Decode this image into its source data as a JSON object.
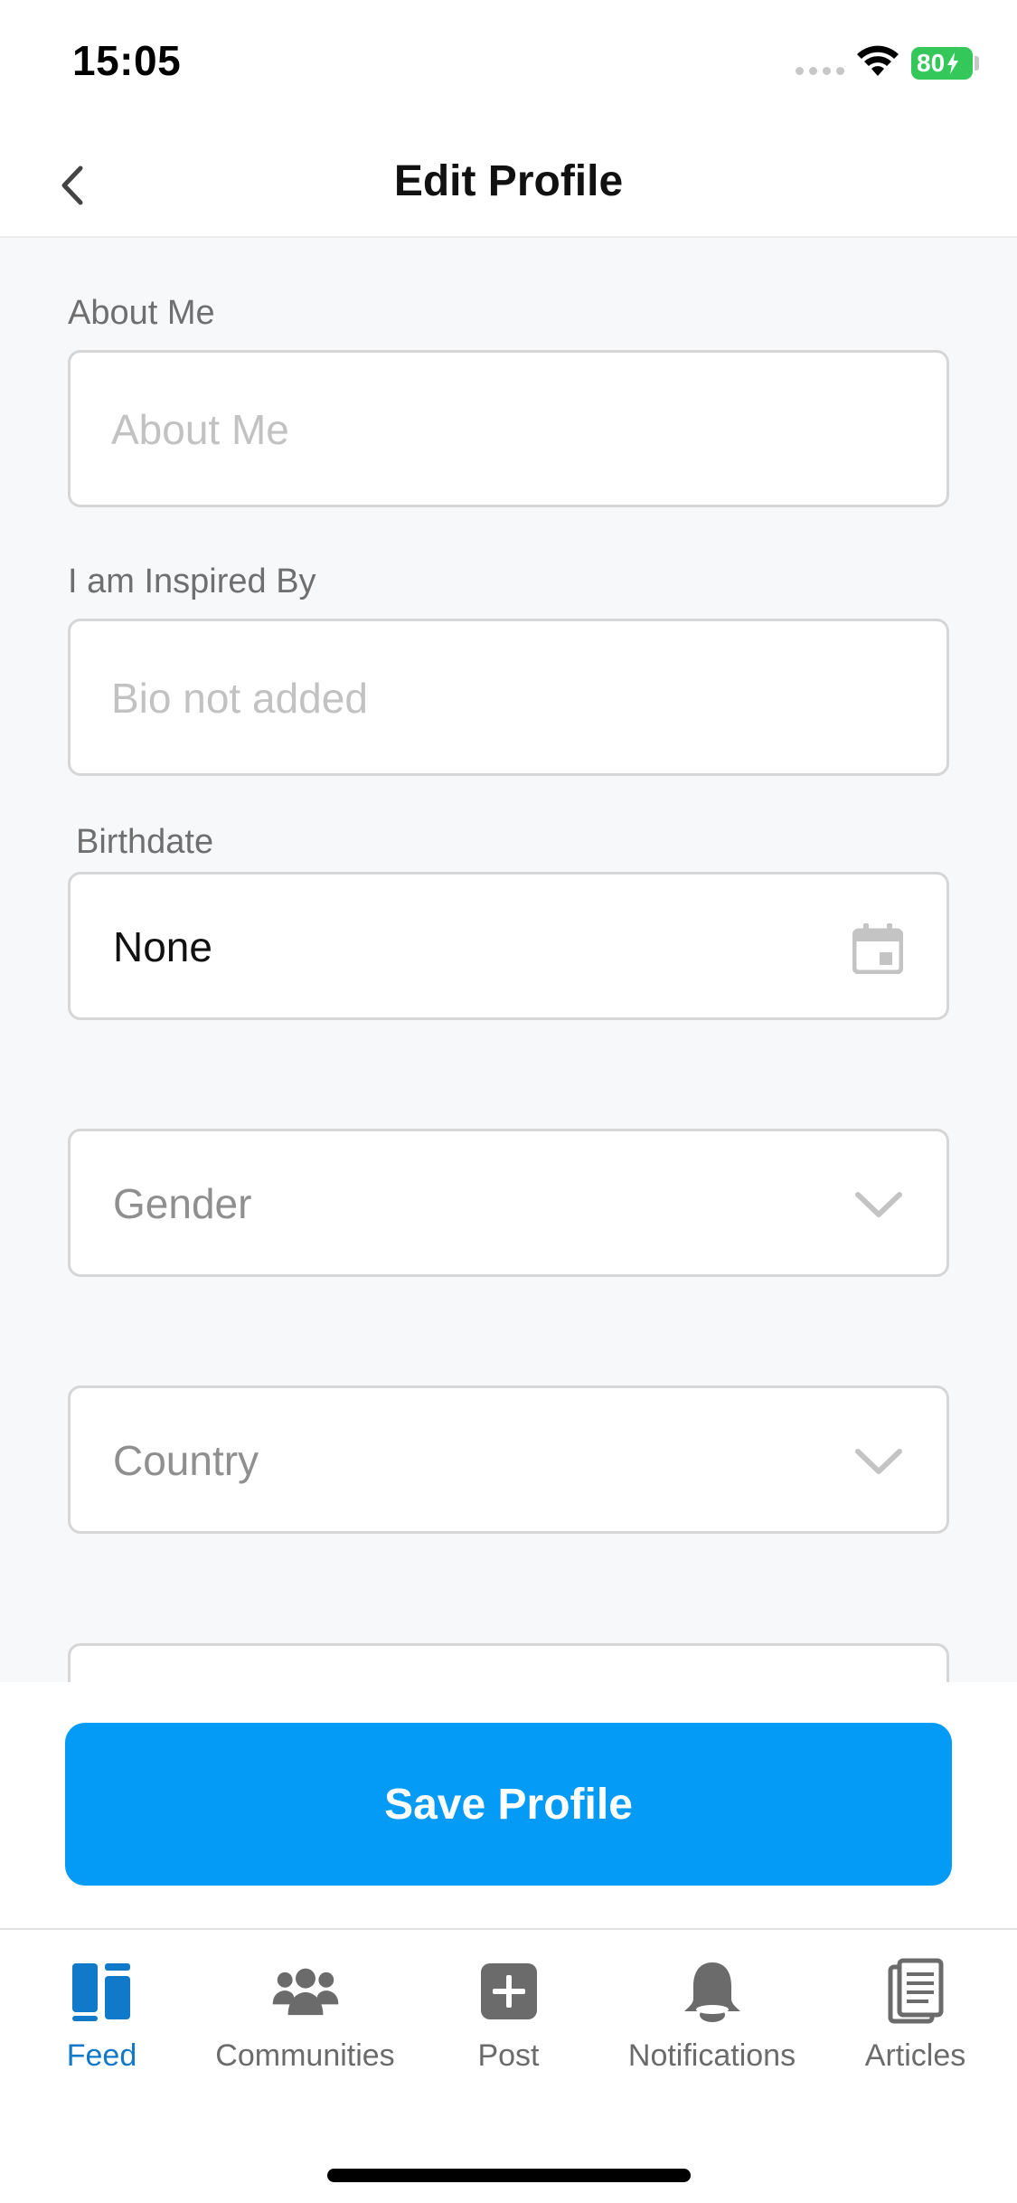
{
  "status_bar": {
    "time": "15:05",
    "battery": "80"
  },
  "header": {
    "title": "Edit Profile",
    "back_icon": "chevron-left-icon"
  },
  "form": {
    "about_me": {
      "label": "About Me",
      "placeholder": "About Me",
      "value": ""
    },
    "inspired_by": {
      "label": "I am Inspired By",
      "placeholder": "Bio not added",
      "value": ""
    },
    "birthdate": {
      "label": "Birthdate",
      "value": "None",
      "icon": "calendar-icon"
    },
    "gender": {
      "placeholder": "Gender",
      "icon": "chevron-down-icon"
    },
    "country": {
      "placeholder": "Country",
      "icon": "chevron-down-icon"
    }
  },
  "actions": {
    "save_label": "Save Profile",
    "save_color": "#039bf5"
  },
  "tab_bar": {
    "active_color": "#1179c9",
    "items": [
      {
        "label": "Feed",
        "icon": "feed-icon",
        "active": true
      },
      {
        "label": "Communities",
        "icon": "people-icon",
        "active": false
      },
      {
        "label": "Post",
        "icon": "plus-square-icon",
        "active": false
      },
      {
        "label": "Notifications",
        "icon": "bell-icon",
        "active": false
      },
      {
        "label": "Articles",
        "icon": "document-icon",
        "active": false
      }
    ]
  }
}
